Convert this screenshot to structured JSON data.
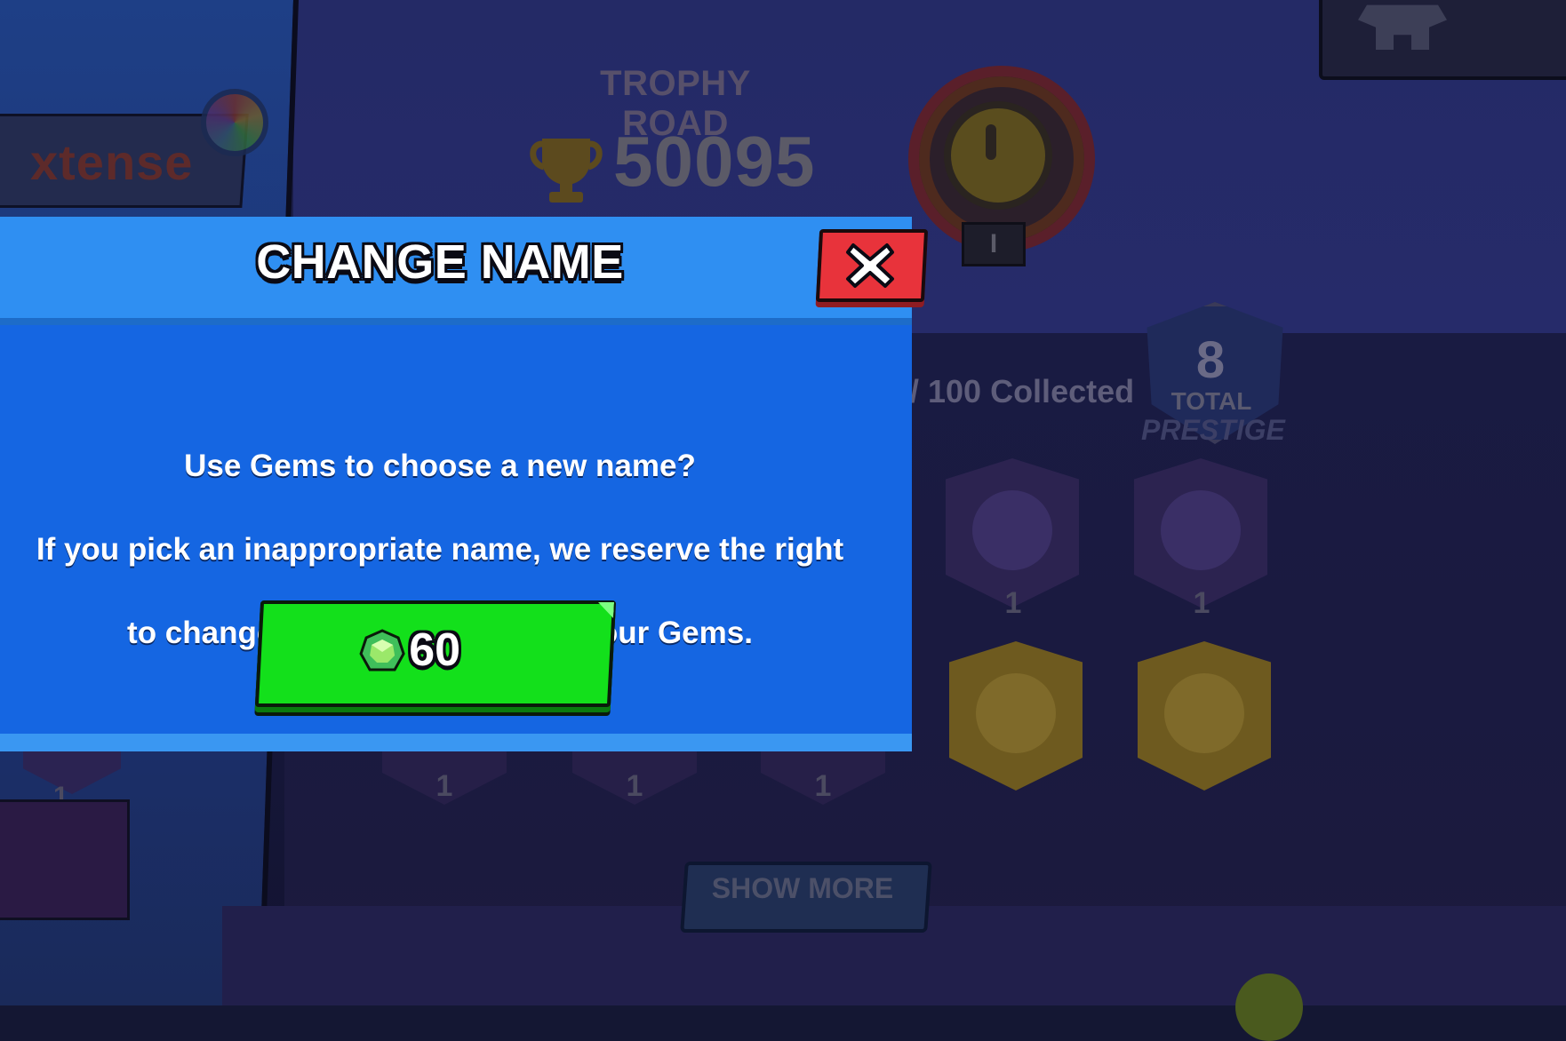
{
  "background": {
    "player_name": "xtense",
    "trophy_road": {
      "title": "TROPHY ROAD",
      "trophies": "50095"
    },
    "rank_tier": "I",
    "collection": {
      "collected_text": "/ 100 Collected"
    },
    "prestige": {
      "total": "8",
      "total_label": "TOTAL",
      "prestige_label": "PRESTIGE"
    },
    "badge_counts": [
      "1",
      "1"
    ],
    "lower_badge_counts": [
      "1",
      "1",
      "1",
      "1"
    ],
    "show_more_label": "SHOW MORE"
  },
  "dialog": {
    "title": "CHANGE NAME",
    "close_icon": "close-x-icon",
    "message_lines": [
      "Use Gems to choose a new name?",
      "If you pick an inappropriate name, we reserve the right",
      "to change it without refunding your Gems."
    ],
    "buy_button": {
      "icon": "gem-icon",
      "price": "60"
    }
  },
  "colors": {
    "header_blue": "#2f8ff2",
    "body_blue": "#1566e2",
    "close_red": "#e8333b",
    "buy_green": "#13e01b"
  }
}
